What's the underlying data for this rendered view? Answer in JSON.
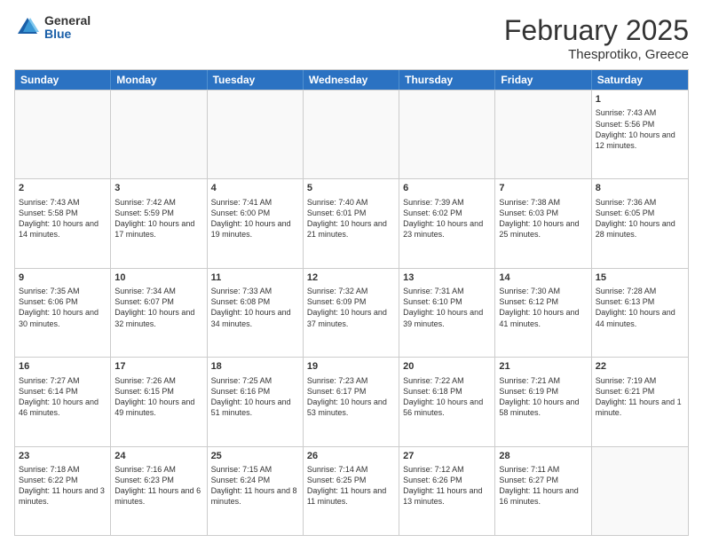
{
  "header": {
    "logo_general": "General",
    "logo_blue": "Blue",
    "month_title": "February 2025",
    "location": "Thesprotiko, Greece"
  },
  "days_of_week": [
    "Sunday",
    "Monday",
    "Tuesday",
    "Wednesday",
    "Thursday",
    "Friday",
    "Saturday"
  ],
  "rows": [
    [
      {
        "day": "",
        "info": ""
      },
      {
        "day": "",
        "info": ""
      },
      {
        "day": "",
        "info": ""
      },
      {
        "day": "",
        "info": ""
      },
      {
        "day": "",
        "info": ""
      },
      {
        "day": "",
        "info": ""
      },
      {
        "day": "1",
        "info": "Sunrise: 7:43 AM\nSunset: 5:56 PM\nDaylight: 10 hours and 12 minutes."
      }
    ],
    [
      {
        "day": "2",
        "info": "Sunrise: 7:43 AM\nSunset: 5:58 PM\nDaylight: 10 hours and 14 minutes."
      },
      {
        "day": "3",
        "info": "Sunrise: 7:42 AM\nSunset: 5:59 PM\nDaylight: 10 hours and 17 minutes."
      },
      {
        "day": "4",
        "info": "Sunrise: 7:41 AM\nSunset: 6:00 PM\nDaylight: 10 hours and 19 minutes."
      },
      {
        "day": "5",
        "info": "Sunrise: 7:40 AM\nSunset: 6:01 PM\nDaylight: 10 hours and 21 minutes."
      },
      {
        "day": "6",
        "info": "Sunrise: 7:39 AM\nSunset: 6:02 PM\nDaylight: 10 hours and 23 minutes."
      },
      {
        "day": "7",
        "info": "Sunrise: 7:38 AM\nSunset: 6:03 PM\nDaylight: 10 hours and 25 minutes."
      },
      {
        "day": "8",
        "info": "Sunrise: 7:36 AM\nSunset: 6:05 PM\nDaylight: 10 hours and 28 minutes."
      }
    ],
    [
      {
        "day": "9",
        "info": "Sunrise: 7:35 AM\nSunset: 6:06 PM\nDaylight: 10 hours and 30 minutes."
      },
      {
        "day": "10",
        "info": "Sunrise: 7:34 AM\nSunset: 6:07 PM\nDaylight: 10 hours and 32 minutes."
      },
      {
        "day": "11",
        "info": "Sunrise: 7:33 AM\nSunset: 6:08 PM\nDaylight: 10 hours and 34 minutes."
      },
      {
        "day": "12",
        "info": "Sunrise: 7:32 AM\nSunset: 6:09 PM\nDaylight: 10 hours and 37 minutes."
      },
      {
        "day": "13",
        "info": "Sunrise: 7:31 AM\nSunset: 6:10 PM\nDaylight: 10 hours and 39 minutes."
      },
      {
        "day": "14",
        "info": "Sunrise: 7:30 AM\nSunset: 6:12 PM\nDaylight: 10 hours and 41 minutes."
      },
      {
        "day": "15",
        "info": "Sunrise: 7:28 AM\nSunset: 6:13 PM\nDaylight: 10 hours and 44 minutes."
      }
    ],
    [
      {
        "day": "16",
        "info": "Sunrise: 7:27 AM\nSunset: 6:14 PM\nDaylight: 10 hours and 46 minutes."
      },
      {
        "day": "17",
        "info": "Sunrise: 7:26 AM\nSunset: 6:15 PM\nDaylight: 10 hours and 49 minutes."
      },
      {
        "day": "18",
        "info": "Sunrise: 7:25 AM\nSunset: 6:16 PM\nDaylight: 10 hours and 51 minutes."
      },
      {
        "day": "19",
        "info": "Sunrise: 7:23 AM\nSunset: 6:17 PM\nDaylight: 10 hours and 53 minutes."
      },
      {
        "day": "20",
        "info": "Sunrise: 7:22 AM\nSunset: 6:18 PM\nDaylight: 10 hours and 56 minutes."
      },
      {
        "day": "21",
        "info": "Sunrise: 7:21 AM\nSunset: 6:19 PM\nDaylight: 10 hours and 58 minutes."
      },
      {
        "day": "22",
        "info": "Sunrise: 7:19 AM\nSunset: 6:21 PM\nDaylight: 11 hours and 1 minute."
      }
    ],
    [
      {
        "day": "23",
        "info": "Sunrise: 7:18 AM\nSunset: 6:22 PM\nDaylight: 11 hours and 3 minutes."
      },
      {
        "day": "24",
        "info": "Sunrise: 7:16 AM\nSunset: 6:23 PM\nDaylight: 11 hours and 6 minutes."
      },
      {
        "day": "25",
        "info": "Sunrise: 7:15 AM\nSunset: 6:24 PM\nDaylight: 11 hours and 8 minutes."
      },
      {
        "day": "26",
        "info": "Sunrise: 7:14 AM\nSunset: 6:25 PM\nDaylight: 11 hours and 11 minutes."
      },
      {
        "day": "27",
        "info": "Sunrise: 7:12 AM\nSunset: 6:26 PM\nDaylight: 11 hours and 13 minutes."
      },
      {
        "day": "28",
        "info": "Sunrise: 7:11 AM\nSunset: 6:27 PM\nDaylight: 11 hours and 16 minutes."
      },
      {
        "day": "",
        "info": ""
      }
    ]
  ]
}
